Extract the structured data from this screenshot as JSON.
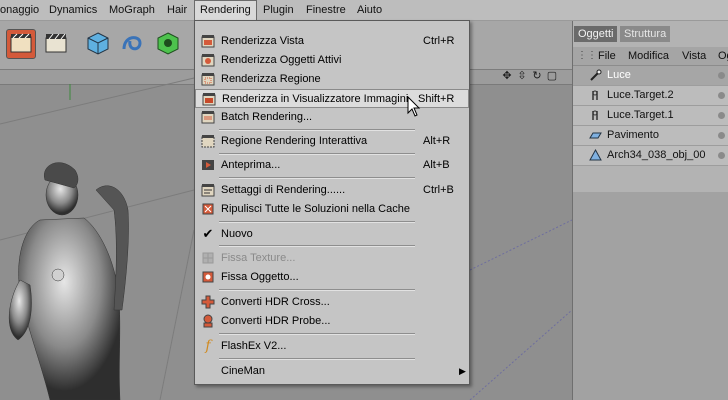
{
  "menubar": {
    "items": [
      "onaggio",
      "Dynamics",
      "MoGraph",
      "Hair",
      "Rendering",
      "Plugin",
      "Finestre",
      "Aiuto"
    ],
    "active": "Rendering"
  },
  "rendering_menu": {
    "items": [
      {
        "label": "Renderizza Vista",
        "shortcut": "Ctrl+R",
        "icon": "render-view-icon"
      },
      {
        "label": "Renderizza Oggetti Attivi",
        "shortcut": "",
        "icon": "render-active-objects-icon"
      },
      {
        "label": "Renderizza Regione",
        "shortcut": "",
        "icon": "render-region-icon"
      },
      {
        "label": "Renderizza in Visualizzatore Immagini",
        "shortcut": "Shift+R",
        "icon": "render-picture-viewer-icon",
        "highlighted": true
      },
      {
        "label": "Batch Rendering...",
        "shortcut": "",
        "icon": "batch-render-icon"
      },
      {
        "label": "Regione Rendering Interattiva",
        "shortcut": "Alt+R",
        "icon": "interactive-render-region-icon"
      },
      {
        "label": "Anteprima...",
        "shortcut": "Alt+B",
        "icon": "preview-icon"
      },
      {
        "label": "Settaggi di Rendering......",
        "shortcut": "Ctrl+B",
        "icon": "render-settings-icon"
      },
      {
        "label": "Ripulisci Tutte le Soluzioni nella Cache",
        "shortcut": "",
        "icon": "flush-cache-icon"
      },
      {
        "label": "Nuovo",
        "shortcut": "",
        "icon": "checkmark-icon",
        "checked": true
      },
      {
        "label": "Fissa Texture...",
        "shortcut": "",
        "icon": "bake-texture-icon",
        "disabled": true
      },
      {
        "label": "Fissa Oggetto...",
        "shortcut": "",
        "icon": "bake-object-icon"
      },
      {
        "label": "Converti HDR Cross...",
        "shortcut": "",
        "icon": "hdr-cross-icon"
      },
      {
        "label": "Converti HDR Probe...",
        "shortcut": "",
        "icon": "hdr-probe-icon"
      },
      {
        "label": "FlashEx V2...",
        "shortcut": "",
        "icon": "flashex-icon"
      },
      {
        "label": "CineMan",
        "shortcut": "",
        "icon": "",
        "submenu": true
      }
    ]
  },
  "object_manager": {
    "tabs": [
      "Oggetti",
      "Struttura"
    ],
    "active_tab": "Oggetti",
    "menu": [
      "File",
      "Modifica",
      "Vista",
      "Og"
    ],
    "objects": [
      {
        "name": "Luce",
        "icon": "light-icon",
        "selected": true
      },
      {
        "name": "Luce.Target.2",
        "icon": "target-icon"
      },
      {
        "name": "Luce.Target.1",
        "icon": "target-icon"
      },
      {
        "name": "Pavimento",
        "icon": "floor-icon"
      },
      {
        "name": "Arch34_038_obj_00",
        "icon": "polygon-object-icon"
      }
    ]
  },
  "colors": {
    "menu_bg": "#c5c5c5",
    "highlight_bg": "#dcdcdc",
    "viewport_bg": "#8f8f8f",
    "panel_tab_selected": "#6b6b6b"
  }
}
